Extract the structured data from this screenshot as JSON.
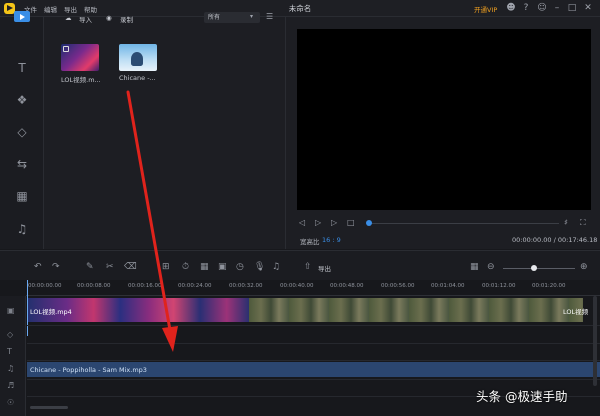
{
  "titlebar": {
    "menu": [
      "文件",
      "编辑",
      "导出",
      "帮助"
    ],
    "title": "未命名",
    "vip": "开通VIP"
  },
  "library": {
    "tabs": [
      "导入",
      "录制"
    ],
    "filter": "所有",
    "items": [
      {
        "label": "LOL视频.m..."
      },
      {
        "label": "Chicane -..."
      }
    ]
  },
  "preview": {
    "ratio_label": "宽高比",
    "ratio_value": "16 : 9",
    "timecode": "00:00:00.00 / 00:17:46.18",
    "progress": 0.0
  },
  "timeline": {
    "export_label": "导出",
    "zoom_level": 0.4,
    "ruler_ticks": [
      "00:00:00.00",
      "00:00:08.00",
      "00:00:16.00",
      "00:00:24.00",
      "00:00:32.00",
      "00:00:40.00",
      "00:00:48.00",
      "00:00:56.00",
      "00:01:04.00",
      "00:01:12.00",
      "00:01:20.00"
    ],
    "video_clips": [
      {
        "label": "LOL视频.mp4"
      },
      {
        "label": "LOL视频"
      }
    ],
    "audio_clip": "Chicane - Poppiholla - Sam Mix.mp3"
  },
  "watermark": "头条 @极速手助",
  "colors": {
    "accent": "#3a8ee6",
    "arrow": "#e0231c",
    "vip": "#f0a020"
  }
}
